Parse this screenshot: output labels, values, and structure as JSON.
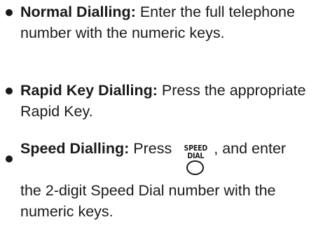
{
  "items": [
    {
      "term": "Normal Dialling:",
      "text": "Enter the full telephone number with the numeric keys."
    },
    {
      "term": "Rapid Key Dialling:",
      "text": "Press the appropriate Rapid Key."
    },
    {
      "term": "Speed Dialling:",
      "text_before": "Press",
      "key_label_line1": "SPEED",
      "key_label_line2": "DIAL",
      "text_after": ", and enter",
      "text_continued": "the 2-digit Speed Dial number with the numeric keys."
    }
  ]
}
